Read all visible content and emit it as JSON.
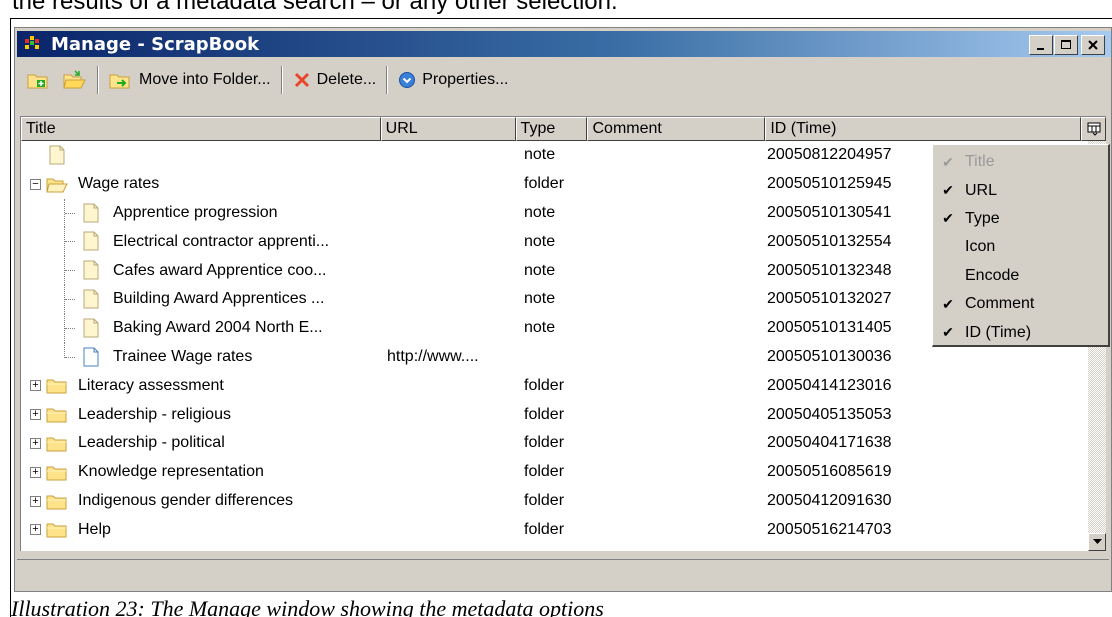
{
  "document": {
    "top_text": "the results of a metadata search – or any other selection.",
    "caption": "Illustration 23: The Manage window showing the metadata options"
  },
  "window": {
    "title": "Manage - ScrapBook",
    "controls": {
      "minimize": "_",
      "maximize": "□",
      "close": "✕"
    }
  },
  "toolbar": {
    "buttons": [
      {
        "icon": "new-folder-icon",
        "label": ""
      },
      {
        "icon": "open-folder-icon",
        "label": ""
      },
      {
        "icon": "move-folder-icon",
        "label": "Move into Folder..."
      },
      {
        "icon": "delete-icon",
        "label": "Delete..."
      },
      {
        "icon": "properties-icon",
        "label": "Properties..."
      }
    ]
  },
  "columns": {
    "title": "Title",
    "url": "URL",
    "type": "Type",
    "comment": "Comment",
    "id": "ID (Time)"
  },
  "rows": [
    {
      "kind": "note",
      "depth": 0,
      "title": "",
      "url": "",
      "type": "note",
      "id": "20050812204957"
    },
    {
      "kind": "folder-open",
      "depth": 0,
      "expander": "−",
      "title": "Wage rates",
      "url": "",
      "type": "folder",
      "id": "20050510125945"
    },
    {
      "kind": "note",
      "depth": 1,
      "title": "Apprentice progression",
      "url": "",
      "type": "note",
      "id": "20050510130541"
    },
    {
      "kind": "note",
      "depth": 1,
      "title": "Electrical contractor apprenti...",
      "url": "",
      "type": "note",
      "id": "20050510132554"
    },
    {
      "kind": "note",
      "depth": 1,
      "title": "Cafes award Apprentice coo...",
      "url": "",
      "type": "note",
      "id": "20050510132348"
    },
    {
      "kind": "note",
      "depth": 1,
      "title": "Building Award Apprentices ...",
      "url": "",
      "type": "note",
      "id": "20050510132027"
    },
    {
      "kind": "note",
      "depth": 1,
      "title": "Baking Award 2004 North E...",
      "url": "",
      "type": "note",
      "id": "20050510131405"
    },
    {
      "kind": "page",
      "depth": 1,
      "title": "Trainee Wage rates",
      "url": "http://www....",
      "type": "",
      "id": "20050510130036"
    },
    {
      "kind": "folder",
      "depth": 0,
      "expander": "+",
      "title": "Literacy assessment",
      "url": "",
      "type": "folder",
      "id": "20050414123016"
    },
    {
      "kind": "folder",
      "depth": 0,
      "expander": "+",
      "title": "Leadership - religious",
      "url": "",
      "type": "folder",
      "id": "20050405135053"
    },
    {
      "kind": "folder",
      "depth": 0,
      "expander": "+",
      "title": "Leadership - political",
      "url": "",
      "type": "folder",
      "id": "20050404171638"
    },
    {
      "kind": "folder",
      "depth": 0,
      "expander": "+",
      "title": "Knowledge representation",
      "url": "",
      "type": "folder",
      "id": "20050516085619"
    },
    {
      "kind": "folder",
      "depth": 0,
      "expander": "+",
      "title": "Indigenous gender differences",
      "url": "",
      "type": "folder",
      "id": "20050412091630"
    },
    {
      "kind": "folder",
      "depth": 0,
      "expander": "+",
      "title": "Help",
      "url": "",
      "type": "folder",
      "id": "20050516214703"
    }
  ],
  "column_menu": {
    "items": [
      {
        "label": "Title",
        "checked": true,
        "disabled": true
      },
      {
        "label": "URL",
        "checked": true,
        "disabled": false
      },
      {
        "label": "Type",
        "checked": true,
        "disabled": false
      },
      {
        "label": "Icon",
        "checked": false,
        "disabled": false
      },
      {
        "label": "Encode",
        "checked": false,
        "disabled": false
      },
      {
        "label": "Comment",
        "checked": true,
        "disabled": false
      },
      {
        "label": "ID (Time)",
        "checked": true,
        "disabled": false
      }
    ]
  },
  "colors": {
    "titlebar_start": "#0a246a",
    "titlebar_end": "#a6caf0",
    "chrome": "#d4d0c8",
    "folder_fill": "#ffe38a",
    "folder_edge": "#c8a13c"
  }
}
